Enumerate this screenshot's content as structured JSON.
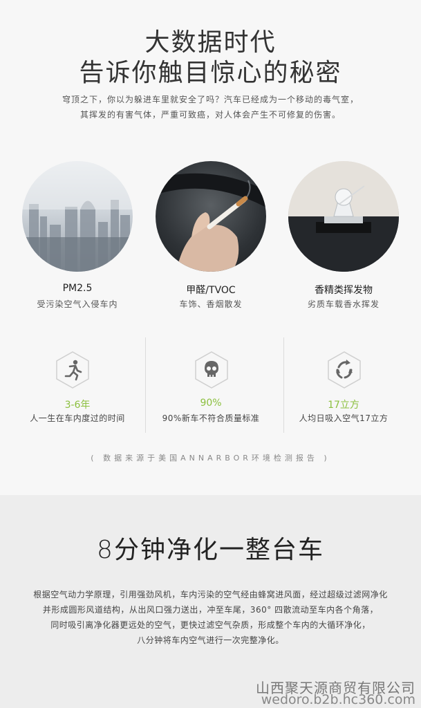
{
  "hero": {
    "title_line1": "大数据时代",
    "title_line2": "告诉你触目惊心的秘密",
    "intro_line1": "穹顶之下，你以为躲进车里就安全了吗？汽车已经成为一个移动的毒气室，",
    "intro_line2": "其挥发的有害气体，严重可致癌，对人体会产生不可修复的伤害。"
  },
  "pollutants": [
    {
      "title": "PM2.5",
      "subtitle": "受污染空气入侵车内",
      "image": "city-smog"
    },
    {
      "title": "甲醛/TVOC",
      "subtitle": "车饰、香烟散发",
      "image": "hand-cigarette"
    },
    {
      "title": "香精类挥发物",
      "subtitle": "劣质车载香水挥发",
      "image": "car-perfume"
    }
  ],
  "stats": [
    {
      "value": "3-6年",
      "label": "人一生在车内度过的时间",
      "icon": "running-person-icon"
    },
    {
      "value": "90%",
      "label": "90%新车不符合质量标准",
      "icon": "skull-icon"
    },
    {
      "value": "17立方",
      "label": "人均日吸入空气17立方",
      "icon": "recycle-icon"
    }
  ],
  "source_note": "( 数据来源于美国ANNARBOR环境检测报告 )",
  "purify": {
    "title": "8分钟净化一整台车",
    "lines": [
      "根据空气动力学原理，引用强劲风机，车内污染的空气经由蜂窝进风面，经过超级过滤网净化",
      "并形成圆形风道结构，从出风口强力送出，冲至车尾，360° 四散流动至车内各个角落，",
      "同时吸引离净化器更远处的空气，更快过滤空气杂质，形成整个车内的大循环净化，",
      "八分钟将车内空气进行一次完整净化。"
    ]
  },
  "watermark": {
    "company": "山西聚天源商贸有限公司",
    "url": "wedoro.b2b.hc360.com"
  },
  "colors": {
    "accent_green": "#8bbf3e",
    "top_bg": "#f7f7f7",
    "bottom_bg": "#ededed"
  }
}
